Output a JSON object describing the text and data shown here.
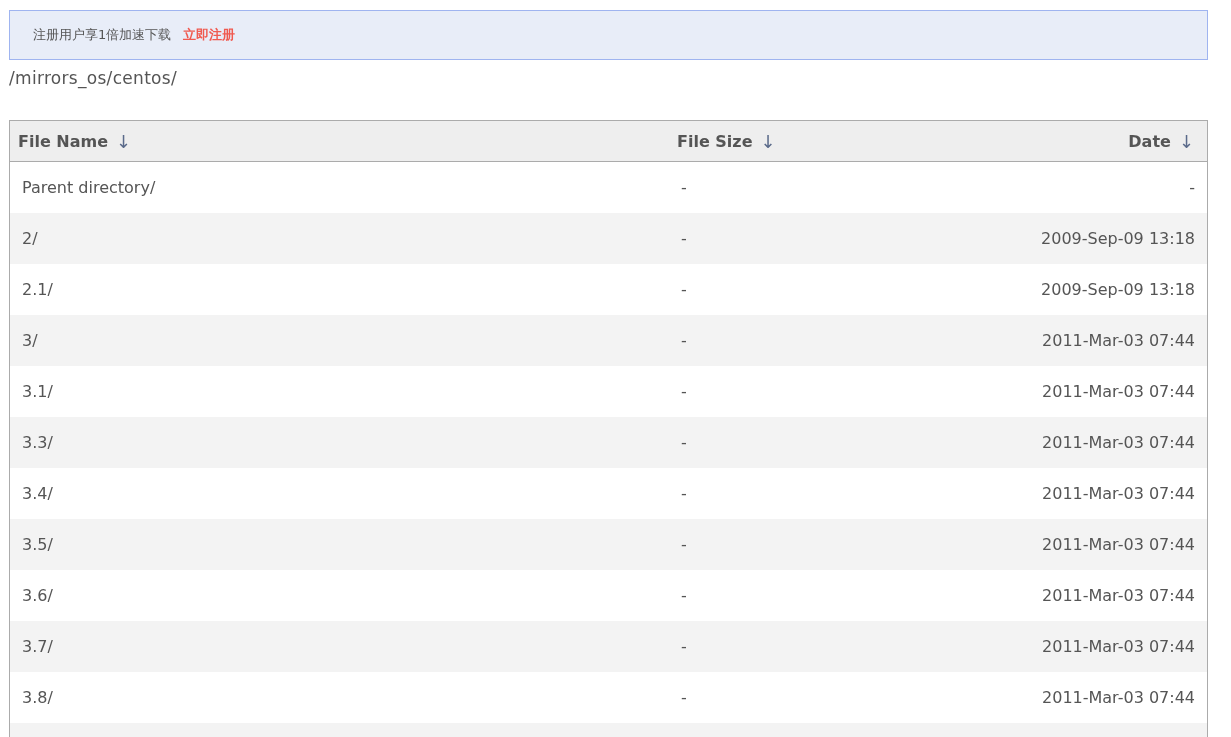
{
  "banner": {
    "text": "注册用户享1倍加速下载",
    "link": "立即注册"
  },
  "path": "/mirrors_os/centos/",
  "table": {
    "columns": [
      {
        "label": "File Name",
        "sort": "↓"
      },
      {
        "label": "File Size",
        "sort": "↓"
      },
      {
        "label": "Date",
        "sort": "↓"
      }
    ],
    "rows": [
      {
        "name": "Parent directory/",
        "size": "-",
        "date": "-"
      },
      {
        "name": "2/",
        "size": "-",
        "date": "2009-Sep-09 13:18"
      },
      {
        "name": "2.1/",
        "size": "-",
        "date": "2009-Sep-09 13:18"
      },
      {
        "name": "3/",
        "size": "-",
        "date": "2011-Mar-03 07:44"
      },
      {
        "name": "3.1/",
        "size": "-",
        "date": "2011-Mar-03 07:44"
      },
      {
        "name": "3.3/",
        "size": "-",
        "date": "2011-Mar-03 07:44"
      },
      {
        "name": "3.4/",
        "size": "-",
        "date": "2011-Mar-03 07:44"
      },
      {
        "name": "3.5/",
        "size": "-",
        "date": "2011-Mar-03 07:44"
      },
      {
        "name": "3.6/",
        "size": "-",
        "date": "2011-Mar-03 07:44"
      },
      {
        "name": "3.7/",
        "size": "-",
        "date": "2011-Mar-03 07:44"
      },
      {
        "name": "3.8/",
        "size": "-",
        "date": "2011-Mar-03 07:44"
      }
    ]
  }
}
